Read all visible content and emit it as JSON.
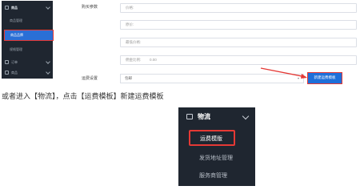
{
  "top_sidebar": {
    "section": "商品",
    "items": [
      "商品管理",
      "商品品牌",
      "规格管理"
    ],
    "active_item": "商品品牌",
    "collapsed": [
      "订单",
      "商品"
    ]
  },
  "form": {
    "section_label": "购买参数",
    "fields": [
      {
        "placeholder": "价格:"
      },
      {
        "placeholder": "原价:"
      },
      {
        "placeholder": "最低价格:"
      },
      {
        "placeholder": "佣金比例:",
        "value": "0.00"
      }
    ],
    "shipping_label": "运费设置",
    "shipping_select": "包邮",
    "new_template_button": "新建运费模板"
  },
  "caption": "或者进入【物流】，点击【运费模板】新建运费模板",
  "logistics_sidebar": {
    "title": "物流",
    "items": [
      "运费模版",
      "发货地址管理",
      "服务商管理"
    ]
  },
  "colors": {
    "sidebar_bg": "#1f2630",
    "highlight_border": "#e53935",
    "primary": "#1e6fd9"
  }
}
